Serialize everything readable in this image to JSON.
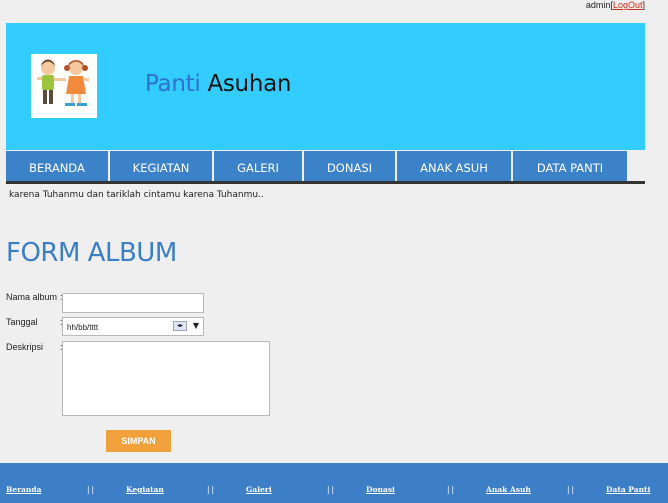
{
  "user": {
    "name": "admin",
    "bracket_open": "[",
    "logout": "LogOut",
    "bracket_close": "]"
  },
  "header": {
    "title_part1": "Panti",
    "title_part2": "Asuhan",
    "logo_icon": "children-logo-icon"
  },
  "nav": [
    "BERANDA",
    "KEGIATAN",
    "GALERI",
    "DONASI",
    "ANAK ASUH",
    "DATA PANTI"
  ],
  "marquee": "karena Tuhanmu dan tariklah cintamu karena Tuhanmu..",
  "form": {
    "title": "FORM ALBUM",
    "name_label": "Nama album",
    "date_label": "Tanggal",
    "desc_label": "Deskripsi",
    "colon": ":",
    "name_value": "",
    "date_placeholder": "hh/bb/tttt",
    "desc_value": "",
    "submit": "SIMPAN"
  },
  "footer": {
    "links": [
      "Beranda",
      "Kegiatan",
      "Galeri",
      "Donasi",
      "Anak Asuh",
      "Data Panti"
    ],
    "separator": "||"
  },
  "colors": {
    "header_bg": "#33ccff",
    "nav_bg": "#3c82c8",
    "title_blue": "#3a7fc3",
    "button": "#f0a13c",
    "footer_bg": "#3c7fc6"
  }
}
